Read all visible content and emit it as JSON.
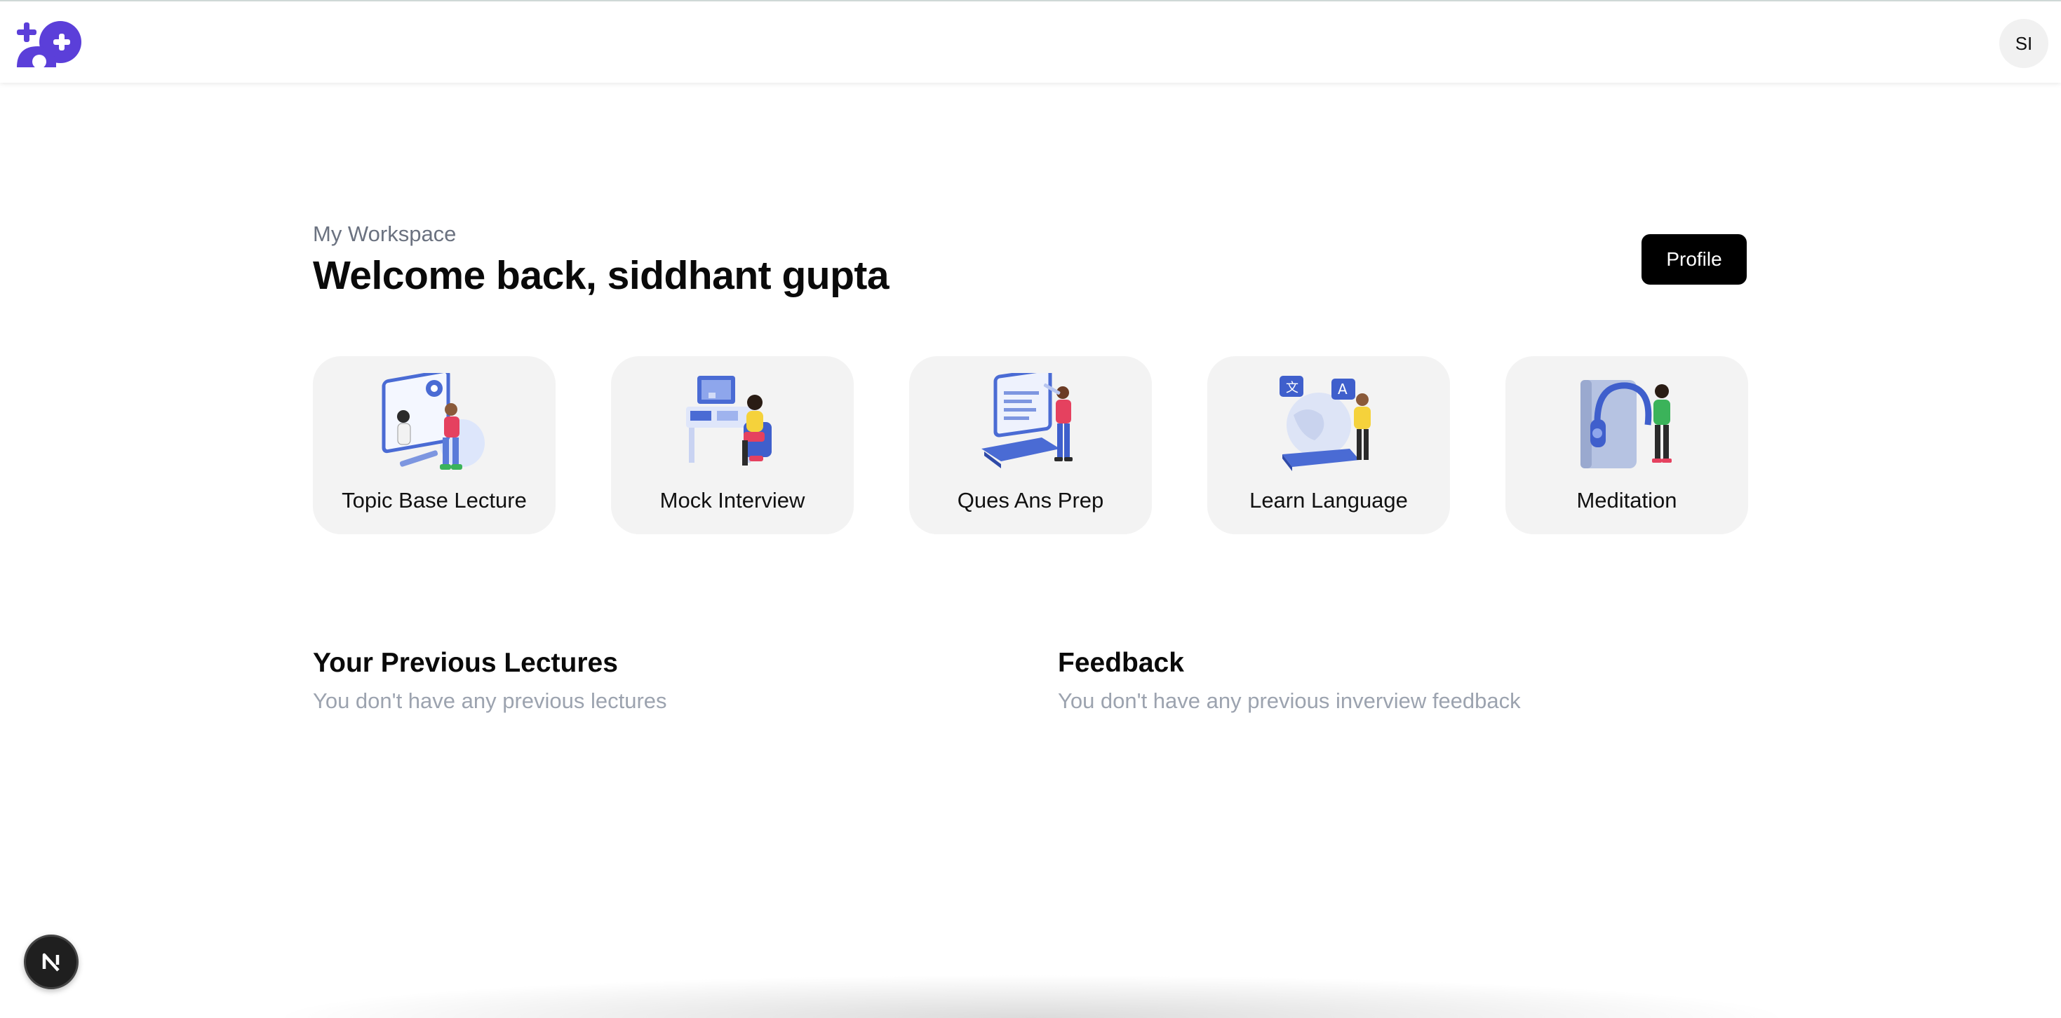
{
  "header": {
    "logo_icon": "gamepad-plus-logo-icon",
    "avatar_initials": "SI",
    "brand_color": "#5b3fd9"
  },
  "main": {
    "workspace_label": "My Workspace",
    "welcome_text": "Welcome back, siddhant gupta",
    "profile_button": "Profile"
  },
  "cards": [
    {
      "label": "Topic Base Lecture",
      "icon": "lecture-illustration-icon"
    },
    {
      "label": "Mock Interview",
      "icon": "interview-illustration-icon"
    },
    {
      "label": "Ques Ans Prep",
      "icon": "qa-prep-illustration-icon"
    },
    {
      "label": "Learn Language",
      "icon": "language-illustration-icon"
    },
    {
      "label": "Meditation",
      "icon": "meditation-illustration-icon"
    }
  ],
  "sections": {
    "lectures": {
      "title": "Your Previous Lectures",
      "empty_text": "You don't have any previous lectures"
    },
    "feedback": {
      "title": "Feedback",
      "empty_text": "You don't have any previous inverview feedback"
    }
  },
  "dev_badge": {
    "letter": "N",
    "icon": "nextjs-devtools-icon"
  }
}
